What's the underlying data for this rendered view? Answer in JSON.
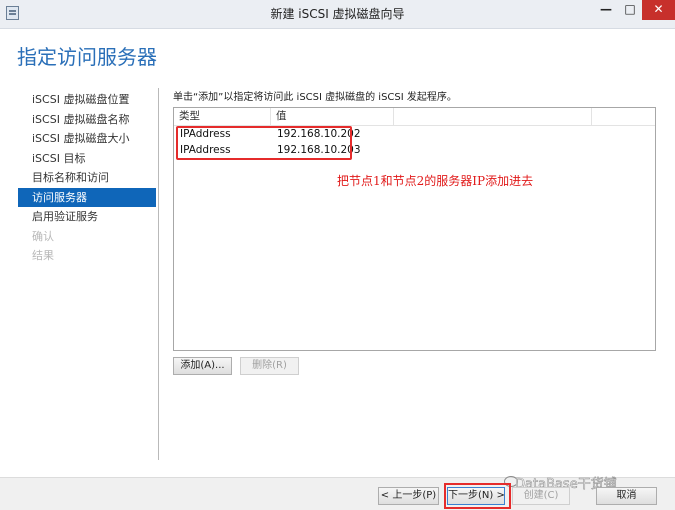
{
  "window": {
    "title": "新建 iSCSI 虚拟磁盘向导",
    "minimize_label": "—",
    "maximize_label": "□",
    "close_label": "✕"
  },
  "page": {
    "title": "指定访问服务器"
  },
  "nav": {
    "items": [
      {
        "label": "iSCSI 虚拟磁盘位置"
      },
      {
        "label": "iSCSI 虚拟磁盘名称"
      },
      {
        "label": "iSCSI 虚拟磁盘大小"
      },
      {
        "label": "iSCSI 目标"
      },
      {
        "label": "目标名称和访问"
      },
      {
        "label": "访问服务器"
      },
      {
        "label": "启用验证服务"
      },
      {
        "label": "确认"
      },
      {
        "label": "结果"
      }
    ],
    "active_index": 5,
    "disabled_indices": [
      7,
      8
    ]
  },
  "main": {
    "instruction": "单击“添加”以指定将访问此 iSCSI 虚拟磁盘的 iSCSI 发起程序。",
    "table": {
      "headers": [
        "类型",
        "值"
      ],
      "rows": [
        {
          "type": "IPAddress",
          "value": "192.168.10.202"
        },
        {
          "type": "IPAddress",
          "value": "192.168.10.203"
        }
      ]
    },
    "annotation": "把节点1和节点2的服务器IP添加进去",
    "add_button": "添加(A)...",
    "remove_button": "删除(R)"
  },
  "footer": {
    "prev_button": "< 上一步(P)",
    "next_button": "下一步(N) >",
    "create_button": "创建(C)",
    "cancel_button": "取消"
  },
  "watermark": {
    "text": "DataBase干货铺"
  },
  "colors": {
    "accent": "#0f66b9",
    "title_blue": "#2a6fb8",
    "annotation_red": "#e11a1a",
    "close_red": "#c7302b"
  }
}
